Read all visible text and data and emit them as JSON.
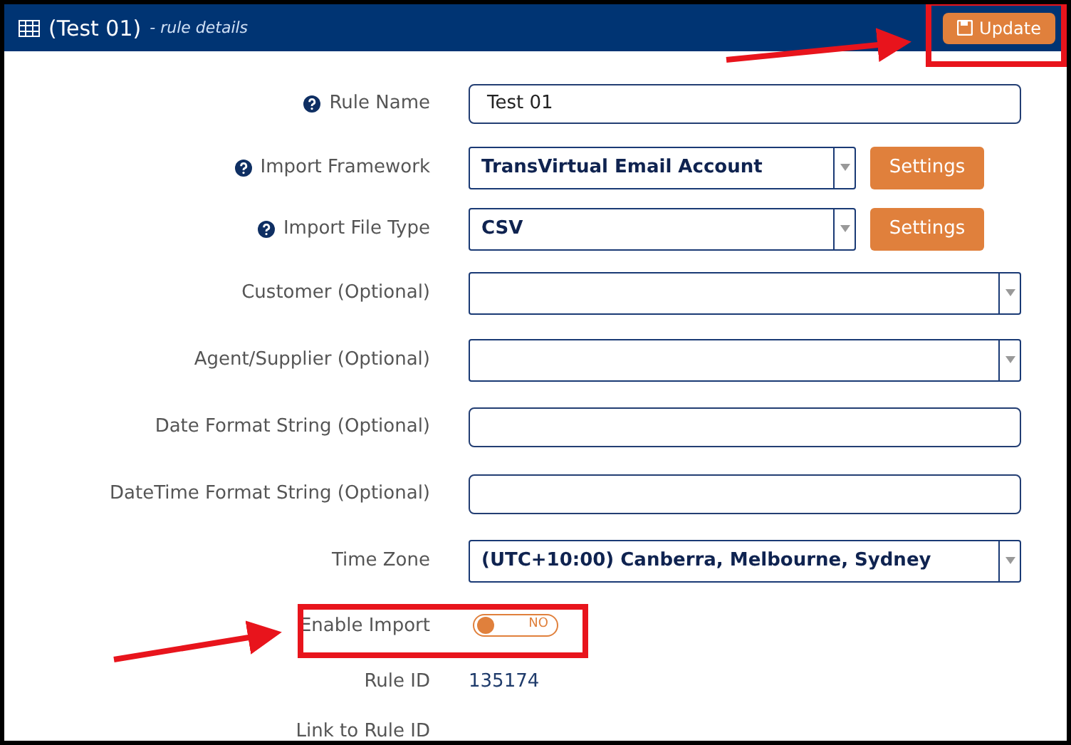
{
  "header": {
    "title": "(Test 01)",
    "subtitle": "- rule details",
    "button": "Update"
  },
  "fields": [
    {
      "kind": "text",
      "label": "Rule Name",
      "help": true,
      "value": "Test 01"
    },
    {
      "kind": "select_settings",
      "label": "Import Framework",
      "help": true,
      "value": "TransVirtual Email Account",
      "button": "Settings"
    },
    {
      "kind": "select_settings",
      "label": "Import File Type",
      "help": true,
      "value": "CSV",
      "button": "Settings"
    },
    {
      "kind": "select",
      "label": "Customer (Optional)",
      "help": false
    },
    {
      "kind": "select",
      "label": "Agent/Supplier (Optional)",
      "help": false
    },
    {
      "kind": "text",
      "label": "Date Format String (Optional)",
      "help": false
    },
    {
      "kind": "text",
      "label": "DateTime Format String (Optional)",
      "help": false
    },
    {
      "kind": "select",
      "label": "Time Zone",
      "help": false,
      "value": "(UTC+10:00) Canberra, Melbourne, Sydney"
    },
    {
      "kind": "toggle",
      "label": "Enable Import",
      "help": false,
      "on": false,
      "state_text": "NO"
    },
    {
      "kind": "static",
      "label": "Rule ID",
      "help": false,
      "value": "135174"
    },
    {
      "kind": "static",
      "label": "Link to Rule ID",
      "help": false
    }
  ]
}
